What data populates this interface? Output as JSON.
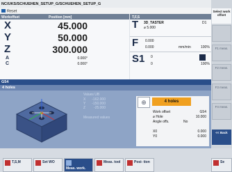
{
  "header": {
    "path": "NC/UKS/SCHUEHEN_SETUP_G/SCHUEHEN_SETUP_G",
    "status": "Reset"
  },
  "position_panel": {
    "col_workoffset": "Workoffset",
    "col_position": "Position [mm]",
    "axes": [
      {
        "name": "X",
        "value": "45.000"
      },
      {
        "name": "Y",
        "value": "50.000"
      },
      {
        "name": "Z",
        "value": "300.000"
      }
    ],
    "small_axes": [
      {
        "name": "A",
        "value": "0.000°"
      },
      {
        "name": "C",
        "value": "0.000°"
      }
    ]
  },
  "tfs": {
    "title": "T,F,S",
    "tool_letter": "T",
    "tool_name": "3D_TASTER",
    "tool_d": "D1",
    "tool_dia": "⌀ 5.000",
    "feed_letter": "F",
    "feed_actual": "0.000",
    "feed_prog": "0.000",
    "feed_unit": "mm/min",
    "feed_pct": "100%",
    "spindle_letter": "S1",
    "spindle_actual": "0",
    "spindle_prog": "0",
    "spindle_pct": "100%"
  },
  "coord_system": "G54",
  "dialog": {
    "title": "4 holes",
    "values_label": "Values UB",
    "values": [
      {
        "axis": "X",
        "value": "-162.000"
      },
      {
        "axis": "Y",
        "value": "-150.000"
      },
      {
        "axis": "Z",
        "value": "-25.000"
      }
    ],
    "measured_label": "Measured values",
    "params": {
      "hole_mode": "4 holes",
      "work_offset_label": "Work offset",
      "work_offset_value": "G54",
      "hole_dia_label": "⌀ Hole",
      "hole_dia_value": "10.000",
      "angle_offs_label": "Angle offs.",
      "angle_offs_value": "No",
      "xo_label": "X0",
      "xo_value": "0.000",
      "yo_label": "Y0",
      "yo_value": "0.000"
    }
  },
  "softkeys_right": [
    {
      "label": "Select work offset",
      "state": "active"
    },
    {
      "label": "",
      "state": "dim"
    },
    {
      "label": "F1 meas.",
      "state": "dim"
    },
    {
      "label": "F2 meas.",
      "state": "dim"
    },
    {
      "label": "F3 meas.",
      "state": "dim"
    },
    {
      "label": "F4 meas.",
      "state": "dim"
    },
    {
      "label": "<< Back",
      "state": "pressed"
    }
  ],
  "softkeys_bottom": [
    {
      "label": "T,S,M",
      "icon": "tsm-icon"
    },
    {
      "label": "Set WO",
      "icon": "set-wo-icon"
    },
    {
      "label": "Meas. work.",
      "icon": "meas-work-icon",
      "pressed": true
    },
    {
      "label": "Meas. tool",
      "icon": "meas-tool-icon"
    },
    {
      "label": "Posi- tion",
      "icon": "position-icon"
    },
    {
      "label": "Se",
      "icon": "settings-icon"
    }
  ]
}
